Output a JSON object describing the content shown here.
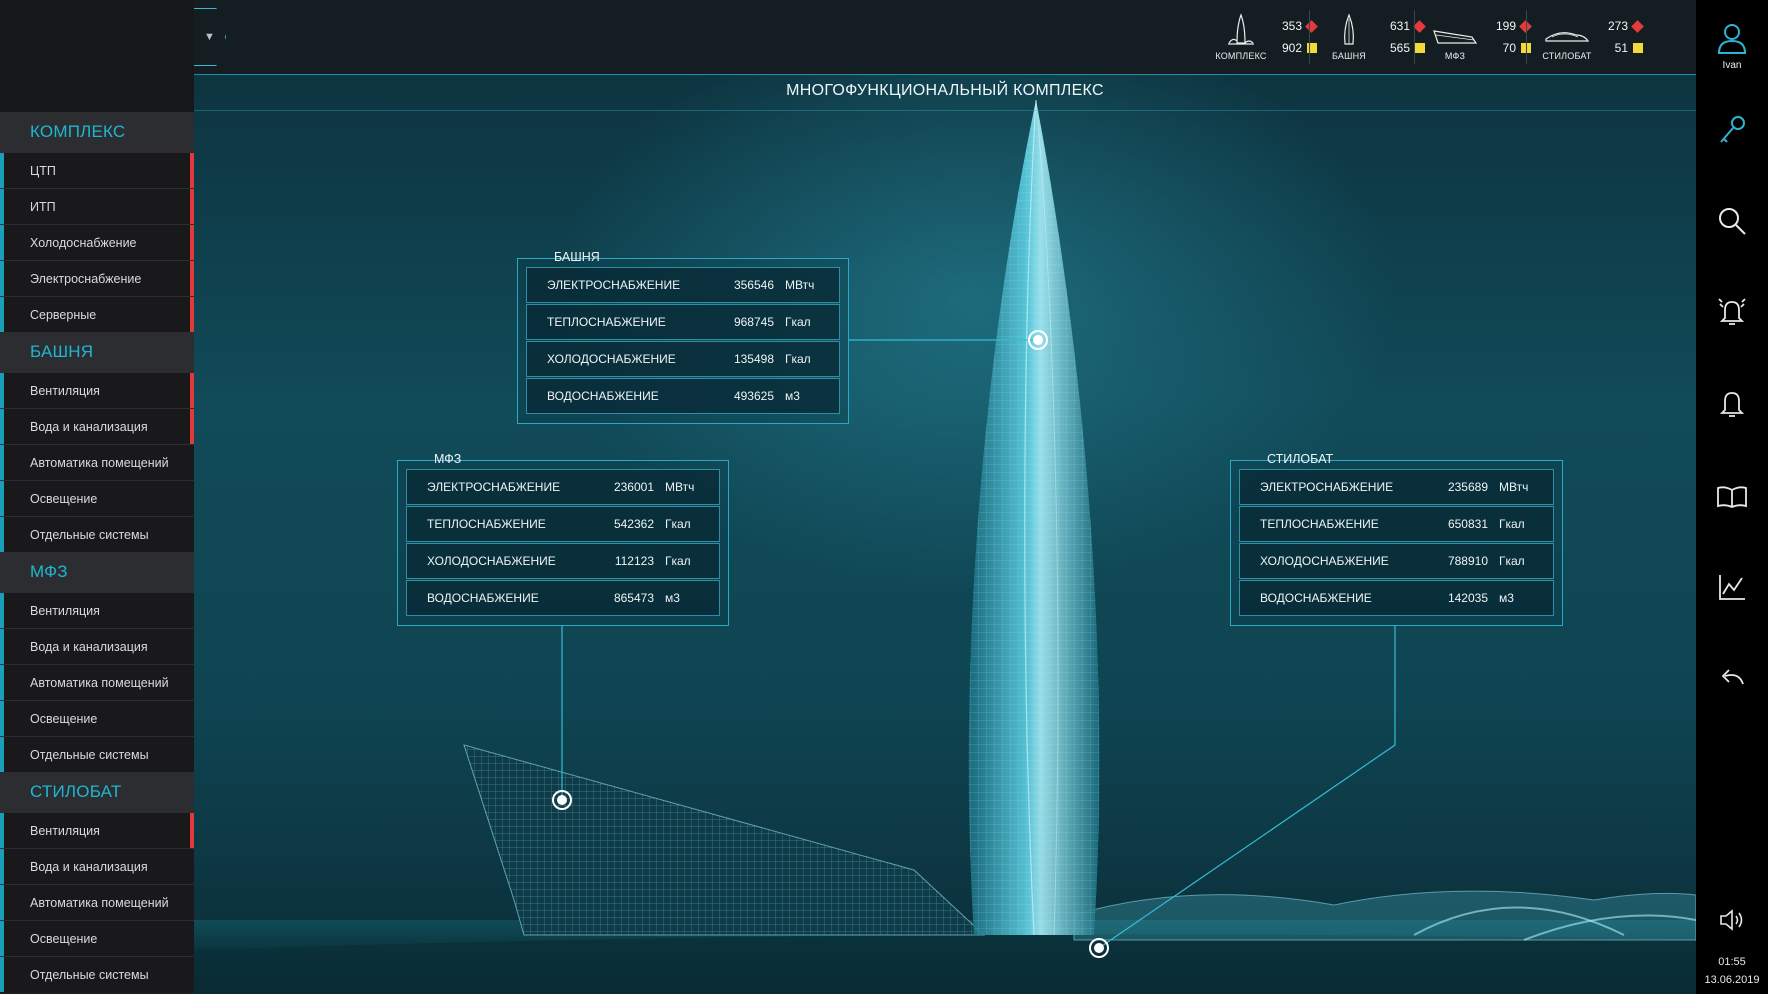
{
  "sidebar": {
    "groups": [
      {
        "title": "КОМПЛЕКС",
        "items": [
          {
            "label": "ЦТП",
            "alarm": true
          },
          {
            "label": "ИТП",
            "alarm": true
          },
          {
            "label": "Холодоснабжение",
            "alarm": true
          },
          {
            "label": "Электроснабжение",
            "alarm": true
          },
          {
            "label": "Серверные",
            "alarm": true
          }
        ]
      },
      {
        "title": "БАШНЯ",
        "items": [
          {
            "label": "Вентиляция",
            "alarm": true
          },
          {
            "label": "Вода и канализация",
            "alarm": true
          },
          {
            "label": "Автоматика помещений",
            "alarm": false
          },
          {
            "label": "Освещение",
            "alarm": false
          },
          {
            "label": "Отдельные системы",
            "alarm": false
          }
        ]
      },
      {
        "title": "МФЗ",
        "items": [
          {
            "label": "Вентиляция",
            "alarm": false
          },
          {
            "label": "Вода и канализация",
            "alarm": false
          },
          {
            "label": "Автоматика помещений",
            "alarm": false
          },
          {
            "label": "Освещение",
            "alarm": false
          },
          {
            "label": "Отдельные системы",
            "alarm": false
          }
        ]
      },
      {
        "title": "СТИЛОБАТ",
        "items": [
          {
            "label": "Вентиляция",
            "alarm": true
          },
          {
            "label": "Вода и канализация",
            "alarm": false
          },
          {
            "label": "Автоматика помещений",
            "alarm": false
          },
          {
            "label": "Освещение",
            "alarm": false
          },
          {
            "label": "Отдельные системы",
            "alarm": false
          }
        ]
      }
    ]
  },
  "topbar": {
    "collapse_icon": "chevron-down-icon",
    "status": [
      {
        "label": "КОМПЛЕКС",
        "icon": "complex-icon",
        "alarms": "353",
        "warnings": "902"
      },
      {
        "label": "БАШНЯ",
        "icon": "tower-icon",
        "alarms": "631",
        "warnings": "565"
      },
      {
        "label": "МФЗ",
        "icon": "mfz-icon",
        "alarms": "199",
        "warnings": "70"
      },
      {
        "label": "СТИЛОБАТ",
        "icon": "stylobate-icon",
        "alarms": "273",
        "warnings": "51"
      }
    ],
    "alarm_color": "#e33b3b",
    "warning_color": "#f1d93a"
  },
  "scene": {
    "title": "МНОГОФУНКЦИОНАЛЬНЫЙ КОМПЛЕКС"
  },
  "panels": {
    "tower": {
      "title": "БАШНЯ",
      "rows": [
        {
          "label": "ЭЛЕКТРОСНАБЖЕНИЕ",
          "value": "356546",
          "unit": "МВтч"
        },
        {
          "label": "ТЕПЛОСНАБЖЕНИЕ",
          "value": "968745",
          "unit": "Гкал"
        },
        {
          "label": "ХОЛОДОСНАБЖЕНИЕ",
          "value": "135498",
          "unit": "Гкал"
        },
        {
          "label": "ВОДОСНАБЖЕНИЕ",
          "value": "493625",
          "unit": "м3"
        }
      ]
    },
    "mfz": {
      "title": "МФЗ",
      "rows": [
        {
          "label": "ЭЛЕКТРОСНАБЖЕНИЕ",
          "value": "236001",
          "unit": "МВтч"
        },
        {
          "label": "ТЕПЛОСНАБЖЕНИЕ",
          "value": "542362",
          "unit": "Гкал"
        },
        {
          "label": "ХОЛОДОСНАБЖЕНИЕ",
          "value": "112123",
          "unit": "Гкал"
        },
        {
          "label": "ВОДОСНАБЖЕНИЕ",
          "value": "865473",
          "unit": "м3"
        }
      ]
    },
    "stylobate": {
      "title": "СТИЛОБАТ",
      "rows": [
        {
          "label": "ЭЛЕКТРОСНАБЖЕНИЕ",
          "value": "235689",
          "unit": "МВтч"
        },
        {
          "label": "ТЕПЛОСНАБЖЕНИЕ",
          "value": "650831",
          "unit": "Гкал"
        },
        {
          "label": "ХОЛОДОСНАБЖЕНИЕ",
          "value": "788910",
          "unit": "Гкал"
        },
        {
          "label": "ВОДОСНАБЖЕНИЕ",
          "value": "142035",
          "unit": "м3"
        }
      ]
    }
  },
  "rightbar": {
    "user_name": "Ivan",
    "icons": [
      "user-icon",
      "key-icon",
      "search-icon",
      "alarm-bell-icon",
      "bell-icon",
      "book-icon",
      "chart-icon",
      "undo-icon",
      "volume-icon"
    ],
    "time": "01:55",
    "date": "13.06.2019"
  },
  "colors": {
    "accent": "#1fb6d2",
    "alarm_bar": "#e03a3a"
  }
}
